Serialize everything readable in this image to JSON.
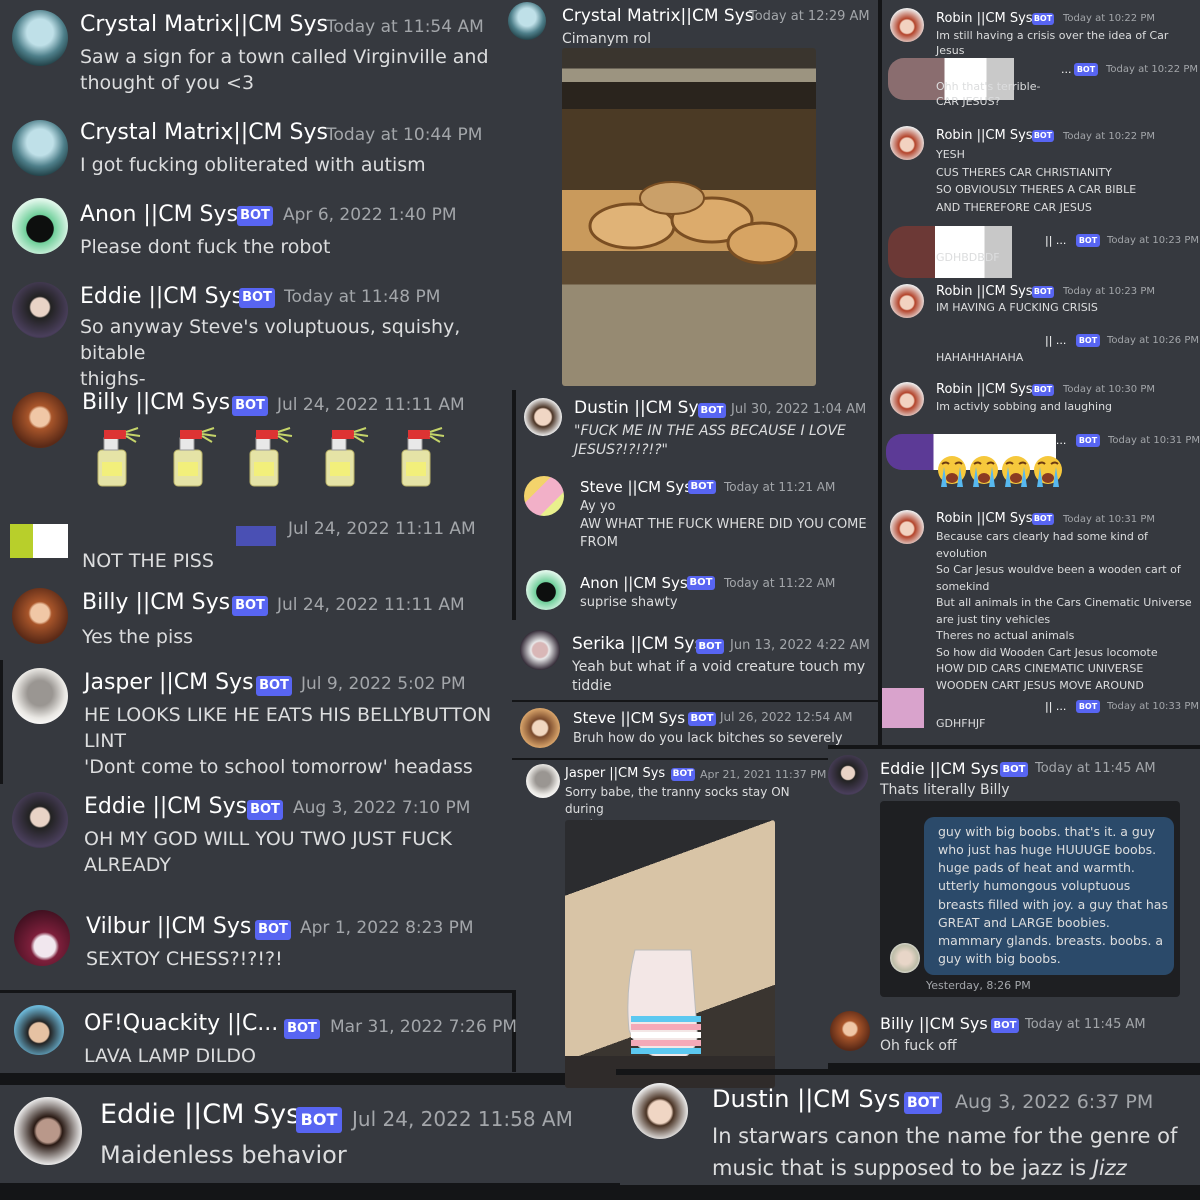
{
  "messages": {
    "m1": {
      "name": "Crystal Matrix||CM Sys",
      "time": "Today at 11:54 AM",
      "text": "Saw a sign for a town called Virginville and\nthought of you <3"
    },
    "m2": {
      "name": "Crystal Matrix||CM Sys",
      "time": "Today at 10:44 PM",
      "text": "I got fucking obliterated with autism"
    },
    "m3": {
      "name": "Anon ||CM Sys",
      "bot": "BOT",
      "time": "Apr 6, 2022 1:40 PM",
      "text": "Please dont fuck the robot"
    },
    "m4": {
      "name": "Eddie ||CM Sys",
      "bot": "BOT",
      "time": "Today at 11:48 PM",
      "text": "So anyway Steve's voluptuous, squishy, bitable\nthighs-"
    },
    "m5": {
      "name": "Billy ||CM Sys",
      "bot": "BOT",
      "time": "Jul 24, 2022 11:11 AM",
      "emoji": "spray-bottle"
    },
    "m6": {
      "time": "Jul 24, 2022 11:11 AM",
      "text": "NOT THE PISS"
    },
    "m7": {
      "name": "Billy ||CM Sys",
      "bot": "BOT",
      "time": "Jul 24, 2022 11:11 AM",
      "text": "Yes the piss"
    },
    "m8": {
      "name": "Jasper ||CM Sys",
      "bot": "BOT",
      "time": "Jul 9, 2022 5:02 PM",
      "text": "HE LOOKS LIKE HE EATS HIS BELLYBUTTON\nLINT\n'Dont come to school tomorrow' headass"
    },
    "m9": {
      "name": "Eddie ||CM Sys",
      "bot": "BOT",
      "time": "Aug 3, 2022 7:10 PM",
      "text": "OH MY GOD WILL YOU TWO JUST FUCK\nALREADY"
    },
    "m10": {
      "name": "Vilbur ||CM Sys",
      "bot": "BOT",
      "time": "Apr 1, 2022 8:23 PM",
      "text": "SEXTOY CHESS?!?!?!"
    },
    "m11": {
      "name": "OF!Quackity ||C...",
      "bot": "BOT",
      "time": "Mar 31, 2022 7:26 PM",
      "text": "LAVA LAMP DILDO"
    },
    "m12": {
      "name": "Eddie ||CM Sys",
      "bot": "BOT",
      "time": "Jul 24, 2022 11:58 AM",
      "text": "Maidenless behavior"
    },
    "m13": {
      "name": "Crystal Matrix||CM Sys",
      "time": "Today at 12:29 AM",
      "text": "Cimanym rol"
    },
    "m14": {
      "name": "Dustin ||CM Sys",
      "bot": "BOT",
      "time": "Jul 30, 2022 1:04 AM",
      "text": "\"FUCK ME IN THE ASS BECAUSE I LOVE\nJESUS?!?!?!?\""
    },
    "m15": {
      "name": "Steve ||CM Sys",
      "bot": "BOT",
      "time": "Today at 11:21 AM",
      "text": "Ay yo\nAW WHAT THE FUCK WHERE DID YOU COME\nFROM"
    },
    "m16": {
      "name": "Anon ||CM Sys",
      "bot": "BOT",
      "time": "Today at 11:22 AM",
      "text": "suprise shawty"
    },
    "m17": {
      "name": "Serika ||CM Sys",
      "bot": "BOT",
      "time": "Jun 13, 2022 4:22 AM",
      "text": "Yeah but what if a void creature touch my\ntiddie"
    },
    "m18": {
      "name": "Steve ||CM Sys",
      "bot": "BOT",
      "time": "Jul 26, 2022 12:54 AM",
      "text": "Bruh how do you lack bitches so severely"
    },
    "m19": {
      "name": "Jasper ||CM Sys",
      "bot": "BOT",
      "time": "Apr 21, 2021 11:37 PM",
      "text": "Sorry babe, the tranny socks stay ON during\nsex/j"
    },
    "m20": {
      "name": "Dustin ||CM Sys",
      "bot": "BOT",
      "time": "Aug 3, 2022 6:37 PM",
      "text": "In starwars canon the name for the genre of\nmusic that is supposed to be jazz is ",
      "em": "Jizz"
    },
    "r1": {
      "name": "Robin ||CM Sys",
      "bot": "BOT",
      "time": "Today at 10:22 PM",
      "text": "Im still having a crisis over the idea of Car Jesus"
    },
    "r2": {
      "name": "...",
      "bot": "BOT",
      "time": "Today at 10:22 PM",
      "text": "Ohh that's terrible-\nCAR JESUS?"
    },
    "r3": {
      "name": "Robin ||CM Sys",
      "bot": "BOT",
      "time": "Today at 10:22 PM",
      "text": "YESH\nCUS THERES CAR CHRISTIANITY\nSO OBVIOUSLY THERES A CAR BIBLE\nAND THEREFORE CAR JESUS"
    },
    "r4": {
      "name": "|| ...",
      "bot": "BOT",
      "time": "Today at 10:23 PM",
      "text": "GDHBDBDF"
    },
    "r5": {
      "name": "Robin ||CM Sys",
      "bot": "BOT",
      "time": "Today at 10:23 PM",
      "text": "IM HAVING A FUCKING CRISIS"
    },
    "r6": {
      "name": "|| ...",
      "bot": "BOT",
      "time": "Today at 10:26 PM",
      "text": "HAHAHHAHAHA"
    },
    "r7": {
      "name": "Robin ||CM Sys",
      "bot": "BOT",
      "time": "Today at 10:30 PM",
      "text": "Im activly sobbing and laughing"
    },
    "r8": {
      "name": "|| ...",
      "bot": "BOT",
      "time": "Today at 10:31 PM",
      "emoji": "loudly-crying"
    },
    "r9": {
      "name": "Robin ||CM Sys",
      "bot": "BOT",
      "time": "Today at 10:31 PM",
      "text": "Because cars clearly had some kind of evolution\nSo Car Jesus wouldve been a wooden cart of\nsomekind\nBut all animals in the Cars Cinematic Universe\nare just tiny vehicles\nTheres no actual animals\nSo how did Wooden Cart Jesus locomote\nHOW DID CARS CINEMATIC UNIVERSE\nWOODEN CART JESUS MOVE AROUND"
    },
    "r10": {
      "name": "|| ...",
      "bot": "BOT",
      "time": "Today at 10:33 PM",
      "text": "GDHFHJF"
    },
    "e1": {
      "name": "Eddie ||CM Sys",
      "bot": "BOT",
      "time": "Today at 11:45 AM",
      "text": "Thats literally Billy"
    },
    "e2": {
      "time": "Yesterday, 8:26 PM",
      "text": "guy with big boobs. that's it. a guy\nwho just has huge HUUUGE boobs.\nhuge pads of heat and warmth.\nutterly humongous voluptuous\nbreasts filled with joy. a guy that has\nGREAT and LARGE boobies.\nmammary glands. breasts. boobs. a\nguy with big boobs."
    },
    "e3": {
      "name": "Billy ||CM Sys",
      "bot": "BOT",
      "time": "Today at 11:45 AM",
      "text": "Oh fuck off"
    }
  },
  "colors": {
    "bg": "#36393f",
    "bot": "#5865f2",
    "name": "#ffffff",
    "time": "#a3a6aa",
    "text": "#dcddde"
  }
}
